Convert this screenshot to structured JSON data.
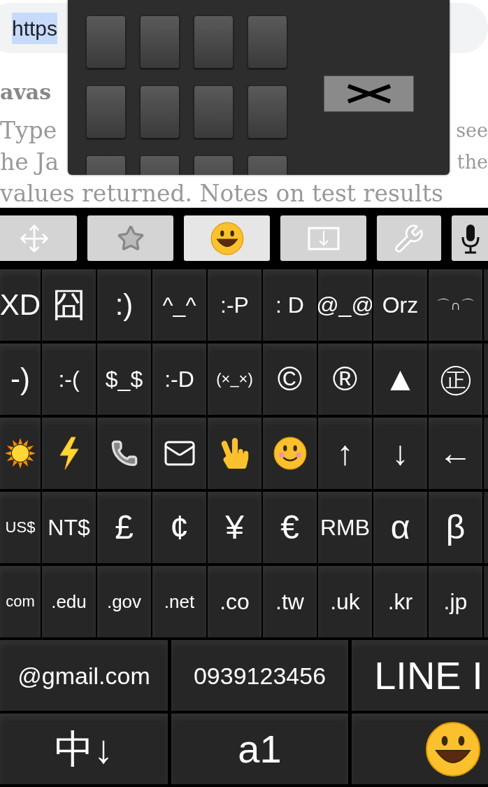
{
  "browser": {
    "url": {
      "text": "https",
      "selected": true
    }
  },
  "page": {
    "heading": "avas",
    "paragraph_lines": [
      {
        "left": "Type",
        "right": "see"
      },
      {
        "left": "he Ja",
        "right": "the"
      },
      {
        "left": "values returned. Notes on test results"
      }
    ]
  },
  "keyboard": {
    "toolbar": [
      {
        "kind": "move",
        "selected": false
      },
      {
        "kind": "star",
        "selected": false
      },
      {
        "kind": "emoji",
        "selected": true
      },
      {
        "kind": "hide",
        "selected": false
      },
      {
        "kind": "settings",
        "selected": false
      },
      {
        "kind": "mic",
        "selected": false
      }
    ],
    "rows": [
      [
        {
          "label": "XD"
        },
        {
          "label": "囧"
        },
        {
          "label": ":)"
        },
        {
          "label": "^_^"
        },
        {
          "label": ":-P"
        },
        {
          "label": ": D"
        },
        {
          "label": "@_@"
        },
        {
          "label": "Orz"
        },
        {
          "label": "⌒∩⌒"
        }
      ],
      [
        {
          "label": "-)"
        },
        {
          "label": ":-("
        },
        {
          "label": "$_$"
        },
        {
          "label": ":-D"
        },
        {
          "label": "(×_×)"
        },
        {
          "label": "©"
        },
        {
          "label": "®"
        },
        {
          "label": "▲"
        },
        {
          "label": "㊣"
        }
      ],
      [
        {
          "kind": "icon"
        },
        {
          "kind": "icon"
        },
        {
          "kind": "icon"
        },
        {
          "kind": "icon"
        },
        {
          "kind": "icon"
        },
        {
          "kind": "icon"
        },
        {
          "label": "↑"
        },
        {
          "label": "↓"
        },
        {
          "label": "←"
        }
      ],
      [
        {
          "label": "US$"
        },
        {
          "label": "NT$"
        },
        {
          "label": "£"
        },
        {
          "label": "¢"
        },
        {
          "label": "¥"
        },
        {
          "label": "€"
        },
        {
          "label": "RMB"
        },
        {
          "label": "α"
        },
        {
          "label": "β"
        }
      ],
      [
        {
          "label": "com"
        },
        {
          "label": ".edu"
        },
        {
          "label": ".gov"
        },
        {
          "label": ".net"
        },
        {
          "label": ".co"
        },
        {
          "label": ".tw"
        },
        {
          "label": ".uk"
        },
        {
          "label": ".kr"
        },
        {
          "label": ".jp"
        }
      ]
    ],
    "wide_rows": [
      [
        {
          "label": "@gmail.com"
        },
        {
          "label": "0939123456"
        },
        {
          "label": "LINE I"
        }
      ],
      [
        {
          "label": "中↓"
        },
        {
          "label": "a1"
        },
        {
          "kind": "icon"
        }
      ]
    ]
  }
}
